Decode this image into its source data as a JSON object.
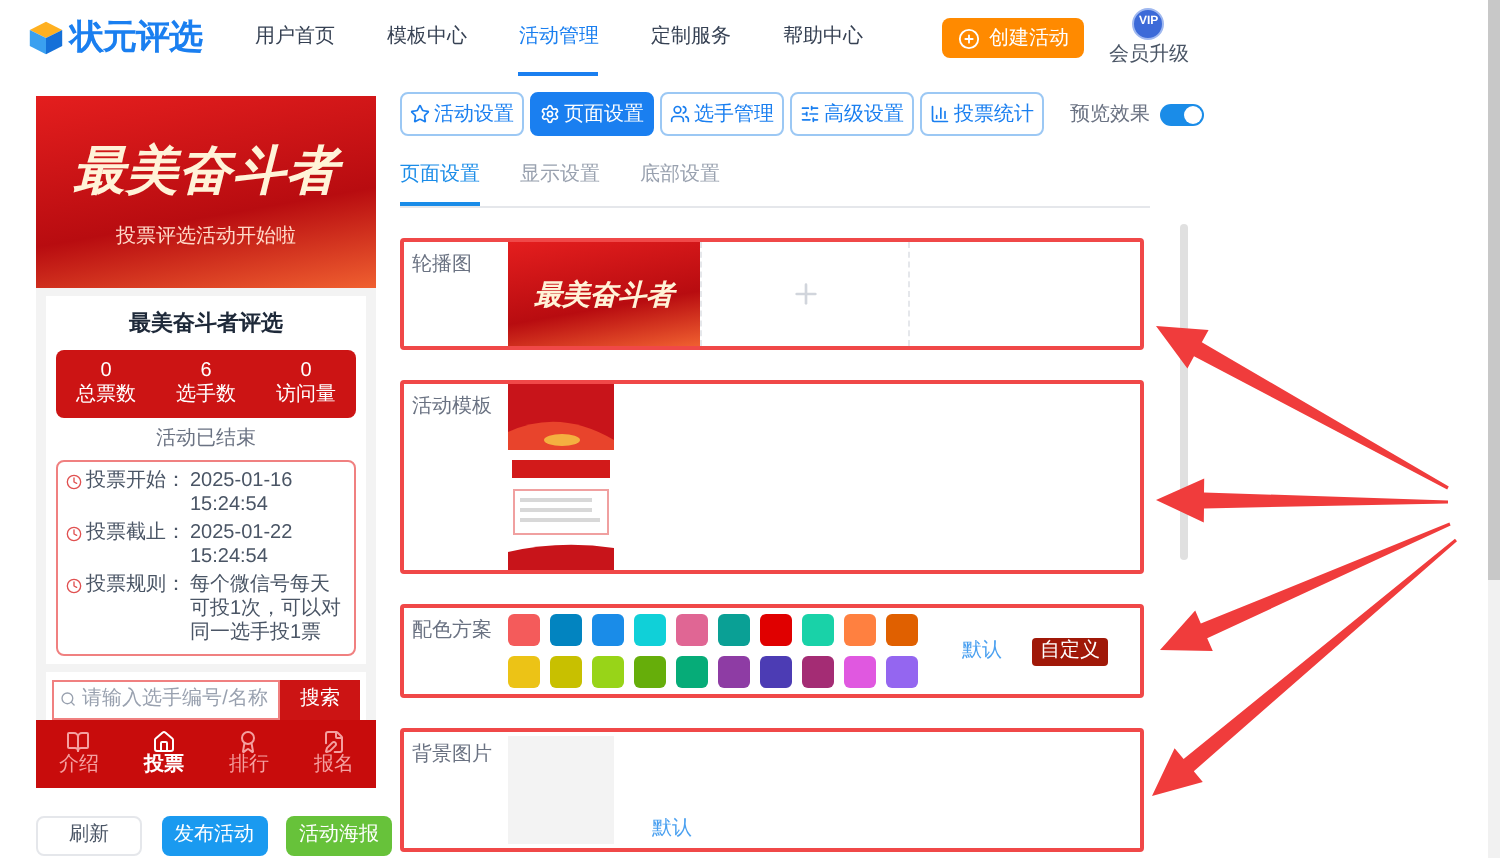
{
  "logo": {
    "text": "状元评选"
  },
  "nav": [
    {
      "label": "用户首页",
      "selected": false
    },
    {
      "label": "模板中心",
      "selected": false
    },
    {
      "label": "活动管理",
      "selected": true
    },
    {
      "label": "定制服务",
      "selected": false
    },
    {
      "label": "帮助中心",
      "selected": false
    }
  ],
  "create_button": "创建活动",
  "vip": {
    "badge": "VIP",
    "label": "会员升级"
  },
  "preview": {
    "banner_title": "最美奋斗者",
    "banner_subtitle": "投票评选活动开始啦",
    "title": "最美奋斗者评选",
    "stats": [
      {
        "value": "0",
        "label": "总票数"
      },
      {
        "value": "6",
        "label": "选手数"
      },
      {
        "value": "0",
        "label": "访问量"
      }
    ],
    "status": "活动已结束",
    "info": [
      {
        "label": "投票开始：",
        "value": "2025-01-16 15:24:54"
      },
      {
        "label": "投票截止：",
        "value": "2025-01-22 15:24:54"
      },
      {
        "label": "投票规则：",
        "value": "每个微信号每天可投1次，可以对同一选手投1票"
      }
    ],
    "search_placeholder": "请输入选手编号/名称",
    "search_button": "搜索",
    "tabs": [
      {
        "label": "介绍",
        "selected": false,
        "kind": "book"
      },
      {
        "label": "投票",
        "selected": true,
        "kind": "home"
      },
      {
        "label": "排行",
        "selected": false,
        "kind": "medal"
      },
      {
        "label": "报名",
        "selected": false,
        "kind": "form"
      }
    ]
  },
  "actions": [
    {
      "label": "刷新",
      "kind": "plain"
    },
    {
      "label": "发布活动",
      "kind": "primary"
    },
    {
      "label": "活动海报",
      "kind": "success"
    }
  ],
  "toolbar": [
    {
      "label": "活动设置",
      "selected": false,
      "kind": "star"
    },
    {
      "label": "页面设置",
      "selected": true,
      "kind": "gear"
    },
    {
      "label": "选手管理",
      "selected": false,
      "kind": "users"
    },
    {
      "label": "高级设置",
      "selected": false,
      "kind": "sliders"
    },
    {
      "label": "投票统计",
      "selected": false,
      "kind": "chart"
    }
  ],
  "preview_toggle": {
    "label": "预览效果",
    "on": true
  },
  "subtabs": [
    {
      "label": "页面设置",
      "selected": true
    },
    {
      "label": "显示设置",
      "selected": false
    },
    {
      "label": "底部设置",
      "selected": false
    }
  ],
  "sections": [
    {
      "kind": "carousel",
      "label": "轮播图",
      "highlighted": true,
      "banner_text": "最美奋斗者"
    },
    {
      "kind": "template",
      "label": "活动模板",
      "highlighted": true
    },
    {
      "kind": "colors",
      "label": "配色方案",
      "highlighted": true,
      "default_link": "默认",
      "custom_button": "自定义",
      "swatches": [
        {
          "color": "#f45b5b"
        },
        {
          "color": "#0284c0"
        },
        {
          "color": "#1a8ce8"
        },
        {
          "color": "#10d0d8"
        },
        {
          "color": "#e06694"
        },
        {
          "color": "#0aa095"
        },
        {
          "color": "#e00000"
        },
        {
          "color": "#19d2a8"
        },
        {
          "color": "#ff8040"
        },
        {
          "color": "#e06000"
        },
        {
          "color": "#ecc316"
        },
        {
          "color": "#c8c000"
        },
        {
          "color": "#98d418"
        },
        {
          "color": "#66ae0a"
        },
        {
          "color": "#06ac78"
        },
        {
          "color": "#8e3ca4"
        },
        {
          "color": "#4c3cb4"
        },
        {
          "color": "#a42c74"
        },
        {
          "color": "#e058e0"
        },
        {
          "color": "#9466f0"
        }
      ]
    },
    {
      "kind": "background",
      "label": "背景图片",
      "highlighted": true,
      "default_link": "默认"
    }
  ]
}
